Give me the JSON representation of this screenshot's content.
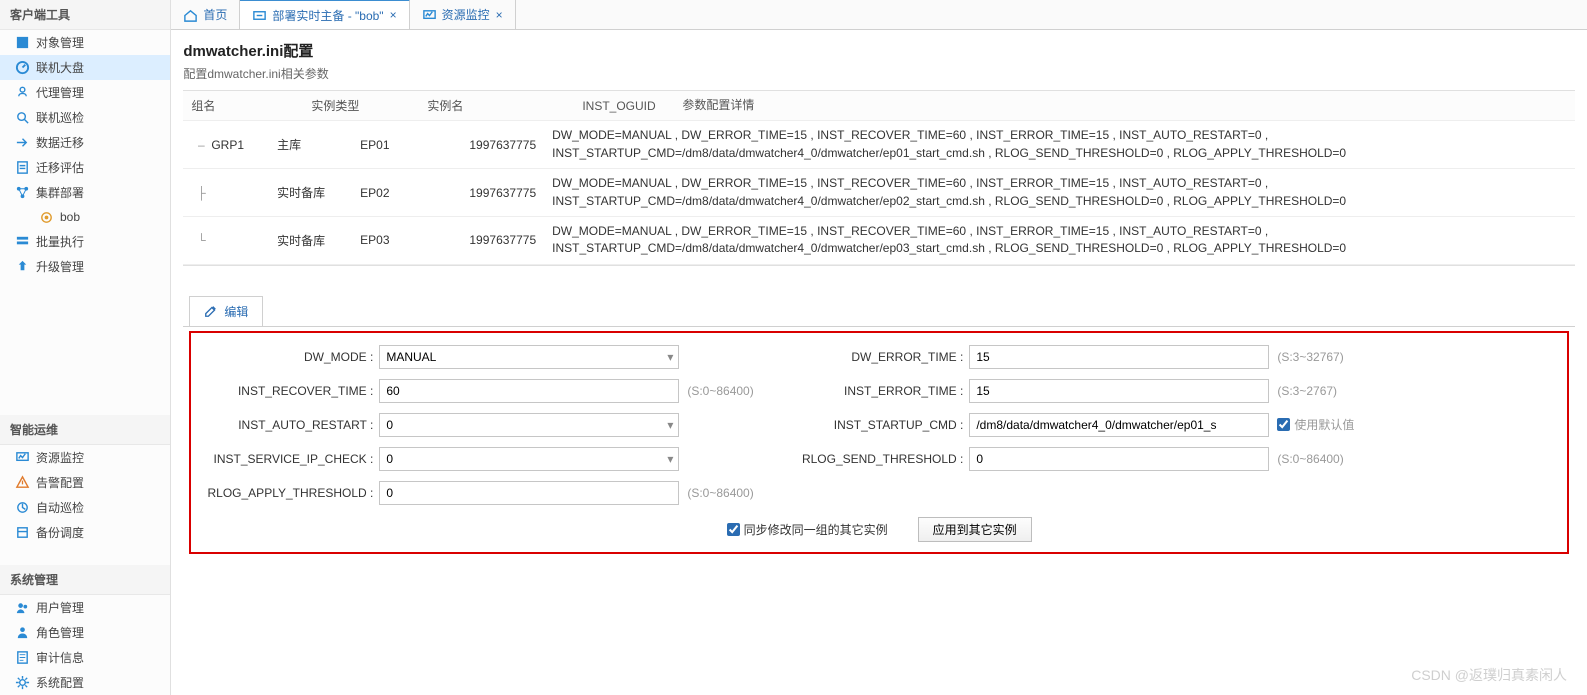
{
  "watermark": "CSDN @返璞归真素闲人",
  "sidebar": {
    "sections": {
      "client_tools": {
        "title": "客户端工具",
        "items": [
          {
            "label": "对象管理",
            "icon": "object",
            "active": false
          },
          {
            "label": "联机大盘",
            "icon": "dashboard",
            "active": true
          },
          {
            "label": "代理管理",
            "icon": "agent",
            "active": false
          },
          {
            "label": "联机巡检",
            "icon": "inspect",
            "active": false
          },
          {
            "label": "数据迁移",
            "icon": "migrate",
            "active": false
          },
          {
            "label": "迁移评估",
            "icon": "assess",
            "active": false
          },
          {
            "label": "集群部署",
            "icon": "cluster",
            "active": false,
            "children": [
              {
                "label": "bob",
                "icon": "job"
              }
            ]
          },
          {
            "label": "批量执行",
            "icon": "batch",
            "active": false
          },
          {
            "label": "升级管理",
            "icon": "upgrade",
            "active": false
          }
        ]
      },
      "smart_ops": {
        "title": "智能运维",
        "items": [
          {
            "label": "资源监控",
            "icon": "monitor"
          },
          {
            "label": "告警配置",
            "icon": "alert"
          },
          {
            "label": "自动巡检",
            "icon": "auto"
          },
          {
            "label": "备份调度",
            "icon": "backup"
          }
        ]
      },
      "sys_mgmt": {
        "title": "系统管理",
        "items": [
          {
            "label": "用户管理",
            "icon": "users"
          },
          {
            "label": "角色管理",
            "icon": "roles"
          },
          {
            "label": "审计信息",
            "icon": "audit"
          },
          {
            "label": "系统配置",
            "icon": "settings"
          }
        ]
      }
    }
  },
  "tabs": [
    {
      "label": "首页",
      "icon": "home",
      "closable": false,
      "active": false
    },
    {
      "label": "部署实时主备 - \"bob\"",
      "icon": "deploy",
      "closable": true,
      "active": true
    },
    {
      "label": "资源监控",
      "icon": "monitor",
      "closable": true,
      "active": false
    }
  ],
  "page": {
    "title": "dmwatcher.ini配置",
    "subtitle": "配置dmwatcher.ini相关参数"
  },
  "grid": {
    "headers": [
      "组名",
      "实例类型",
      "实例名",
      "INST_OGUID",
      "参数配置详情"
    ],
    "rows": [
      {
        "indent": "parent",
        "group": "GRP1",
        "type": "主库",
        "name": "EP01",
        "oguid": "1997637775",
        "detail": "DW_MODE=MANUAL , DW_ERROR_TIME=15 , INST_RECOVER_TIME=60 , INST_ERROR_TIME=15 , INST_AUTO_RESTART=0 , INST_STARTUP_CMD=/dm8/data/dmwatcher4_0/dmwatcher/ep01_start_cmd.sh , RLOG_SEND_THRESHOLD=0 , RLOG_APPLY_THRESHOLD=0"
      },
      {
        "indent": "child",
        "group": "",
        "type": "实时备库",
        "name": "EP02",
        "oguid": "1997637775",
        "detail": "DW_MODE=MANUAL , DW_ERROR_TIME=15 , INST_RECOVER_TIME=60 , INST_ERROR_TIME=15 , INST_AUTO_RESTART=0 , INST_STARTUP_CMD=/dm8/data/dmwatcher4_0/dmwatcher/ep02_start_cmd.sh , RLOG_SEND_THRESHOLD=0 , RLOG_APPLY_THRESHOLD=0"
      },
      {
        "indent": "childlast",
        "group": "",
        "type": "实时备库",
        "name": "EP03",
        "oguid": "1997637775",
        "detail": "DW_MODE=MANUAL , DW_ERROR_TIME=15 , INST_RECOVER_TIME=60 , INST_ERROR_TIME=15 , INST_AUTO_RESTART=0 , INST_STARTUP_CMD=/dm8/data/dmwatcher4_0/dmwatcher/ep03_start_cmd.sh , RLOG_SEND_THRESHOLD=0 , RLOG_APPLY_THRESHOLD=0"
      }
    ]
  },
  "edit_tab": {
    "label": "编辑"
  },
  "form": {
    "fields": {
      "dw_mode": {
        "label": "DW_MODE",
        "value": "MANUAL",
        "type": "select",
        "hint": ""
      },
      "dw_error_time": {
        "label": "DW_ERROR_TIME",
        "value": "15",
        "type": "text",
        "hint": "(S:3~32767)"
      },
      "inst_recover_time": {
        "label": "INST_RECOVER_TIME",
        "value": "60",
        "type": "text",
        "hint": "(S:0~86400)"
      },
      "inst_error_time": {
        "label": "INST_ERROR_TIME",
        "value": "15",
        "type": "text",
        "hint": "(S:3~2767)"
      },
      "inst_auto_restart": {
        "label": "INST_AUTO_RESTART",
        "value": "0",
        "type": "select",
        "hint": ""
      },
      "inst_startup_cmd": {
        "label": "INST_STARTUP_CMD",
        "value": "/dm8/data/dmwatcher4_0/dmwatcher/ep01_s",
        "type": "text",
        "hint": "",
        "extra_checkbox": {
          "label": "使用默认值",
          "checked": true
        }
      },
      "inst_service_ip_check": {
        "label": "INST_SERVICE_IP_CHECK",
        "value": "0",
        "type": "select",
        "hint": ""
      },
      "rlog_send_threshold": {
        "label": "RLOG_SEND_THRESHOLD",
        "value": "0",
        "type": "text",
        "hint": "(S:0~86400)"
      },
      "rlog_apply_threshold": {
        "label": "RLOG_APPLY_THRESHOLD",
        "value": "0",
        "type": "text",
        "hint": "(S:0~86400)"
      }
    },
    "sync_checkbox": {
      "label": "同步修改同一组的其它实例",
      "checked": true
    },
    "apply_button": "应用到其它实例"
  }
}
